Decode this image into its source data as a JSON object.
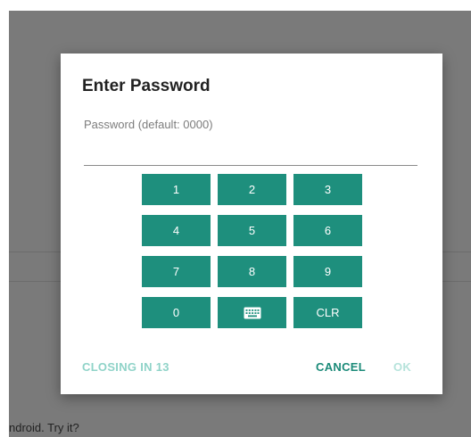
{
  "background": {
    "text": "ndroid. Try it?"
  },
  "dialog": {
    "title": "Enter Password",
    "password_label": "Password (default: 0000)",
    "password_value": "",
    "keypad": {
      "keys": [
        "1",
        "2",
        "3",
        "4",
        "5",
        "6",
        "7",
        "8",
        "9",
        "0",
        "keyboard-icon",
        "CLR"
      ]
    },
    "footer": {
      "closing_text": "CLOSING IN 13",
      "cancel_label": "CANCEL",
      "ok_label": "OK"
    }
  },
  "colors": {
    "overlay": "#7a7a7a",
    "accent": "#1e8f7d",
    "accent_text": "#1a8a78",
    "disabled_text": "#b6e3db",
    "hint_text": "#8fd3c8"
  }
}
